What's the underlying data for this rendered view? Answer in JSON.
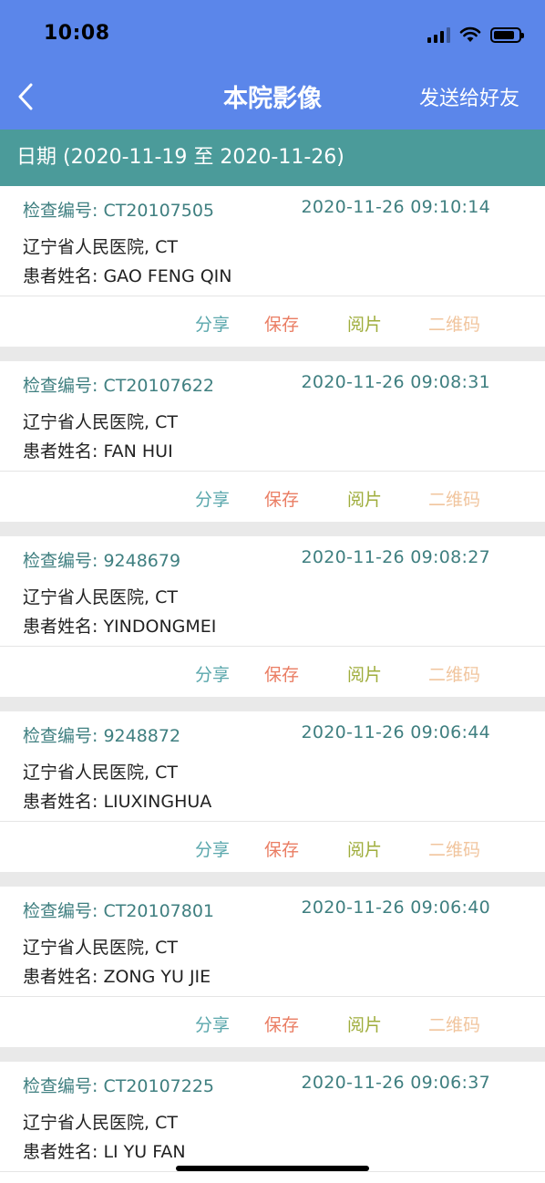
{
  "status_bar": {
    "time": "10:08"
  },
  "nav": {
    "back_icon": "chevron-left-icon",
    "title": "本院影像",
    "right_action": "发送给好友"
  },
  "filter": {
    "date_range": "日期 (2020-11-19 至 2020-11-26)"
  },
  "actions": {
    "share": "分享",
    "save": "保存",
    "read": "阅片",
    "qr": "二维码"
  },
  "colors": {
    "header": "#5b86ea",
    "date_bar": "#4b9b9a",
    "teal_text": "#3f7f80",
    "share": "#5aa7ac",
    "save": "#ea7d63",
    "read": "#9fad3c",
    "qr": "#f1c59e"
  },
  "records": [
    {
      "exam_no": "检查编号: CT20107505",
      "time": "2020-11-26 09:10:14",
      "hospital": "辽宁省人民医院, CT",
      "patient": "患者姓名: GAO FENG QIN"
    },
    {
      "exam_no": "检查编号: CT20107622",
      "time": "2020-11-26 09:08:31",
      "hospital": "辽宁省人民医院, CT",
      "patient": "患者姓名: FAN HUI"
    },
    {
      "exam_no": "检查编号: 9248679",
      "time": "2020-11-26 09:08:27",
      "hospital": "辽宁省人民医院, CT",
      "patient": "患者姓名: YINDONGMEI"
    },
    {
      "exam_no": "检查编号: 9248872",
      "time": "2020-11-26 09:06:44",
      "hospital": "辽宁省人民医院, CT",
      "patient": "患者姓名: LIUXINGHUA"
    },
    {
      "exam_no": "检查编号: CT20107801",
      "time": "2020-11-26 09:06:40",
      "hospital": "辽宁省人民医院, CT",
      "patient": "患者姓名: ZONG YU JIE"
    },
    {
      "exam_no": "检查编号: CT20107225",
      "time": "2020-11-26 09:06:37",
      "hospital": "辽宁省人民医院, CT",
      "patient": "患者姓名: LI YU FAN"
    }
  ]
}
